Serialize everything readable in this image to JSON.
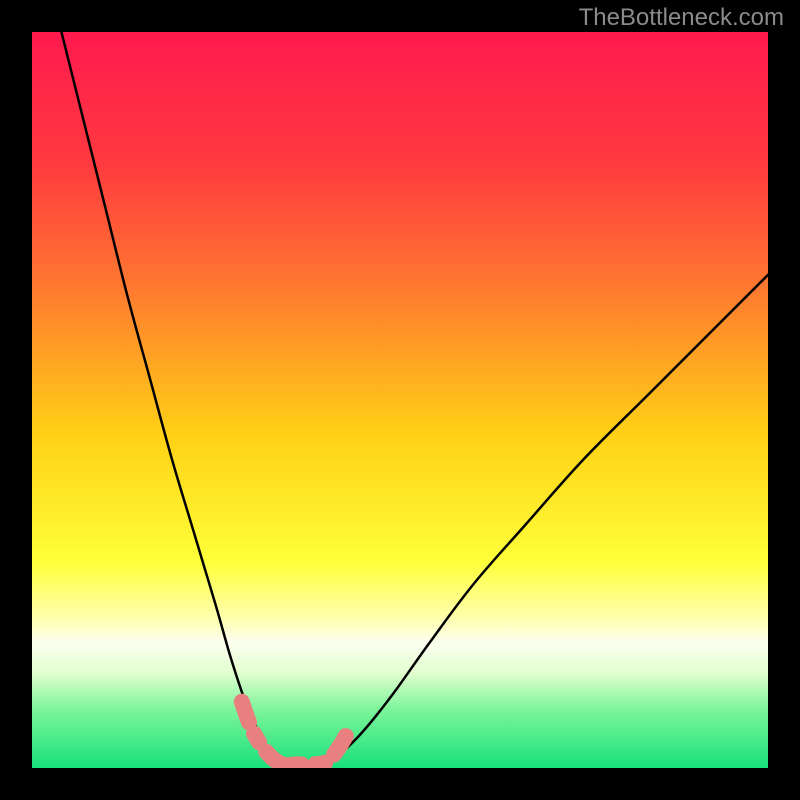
{
  "watermark": "TheBottleneck.com",
  "chart_data": {
    "type": "line",
    "title": "",
    "xlabel": "",
    "ylabel": "",
    "xlim": [
      0,
      100
    ],
    "ylim": [
      0,
      100
    ],
    "background_gradient": {
      "stops": [
        {
          "offset": 0.0,
          "color": "#ff1a4e"
        },
        {
          "offset": 0.18,
          "color": "#ff3a3f"
        },
        {
          "offset": 0.35,
          "color": "#ff7a2f"
        },
        {
          "offset": 0.55,
          "color": "#ffd215"
        },
        {
          "offset": 0.72,
          "color": "#ffff3a"
        },
        {
          "offset": 0.8,
          "color": "#ffffb5"
        },
        {
          "offset": 0.83,
          "color": "#fbfff0"
        },
        {
          "offset": 0.87,
          "color": "#e3ffd0"
        },
        {
          "offset": 0.92,
          "color": "#7ef59b"
        },
        {
          "offset": 1.0,
          "color": "#18e07a"
        }
      ]
    },
    "series": [
      {
        "name": "left-branch",
        "color": "#000000",
        "x": [
          4,
          7,
          10,
          13,
          16,
          19,
          22,
          25,
          27,
          29,
          31,
          32.5,
          34
        ],
        "y": [
          100,
          88,
          76,
          64,
          53,
          42,
          32,
          22,
          15,
          9,
          4.5,
          2,
          0.5
        ]
      },
      {
        "name": "right-branch",
        "color": "#000000",
        "x": [
          40,
          42,
          45,
          49,
          54,
          60,
          67,
          75,
          84,
          93,
          100
        ],
        "y": [
          0.5,
          2,
          5,
          10,
          17,
          25,
          33,
          42,
          51,
          60,
          67
        ]
      },
      {
        "name": "bottom-overlay",
        "color": "#e98080",
        "x": [
          28.5,
          30,
          32,
          34,
          36,
          38,
          40,
          41.5,
          43,
          44.5
        ],
        "y": [
          9,
          5,
          2,
          0.5,
          0.5,
          0.5,
          0.8,
          2.5,
          5,
          8
        ]
      }
    ]
  }
}
